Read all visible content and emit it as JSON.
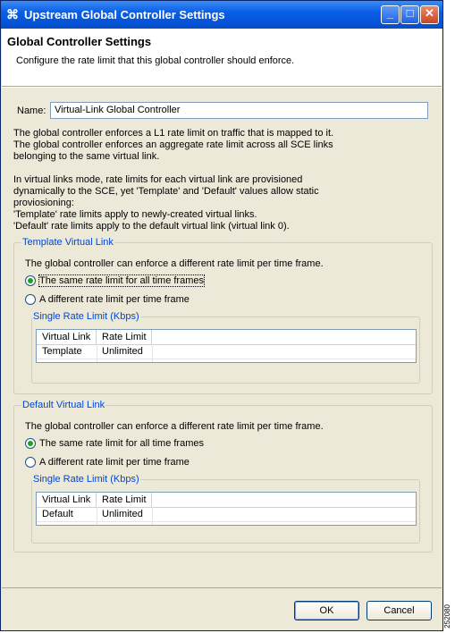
{
  "window": {
    "title": "Upstream Global Controller Settings",
    "minimize_glyph": "_",
    "maximize_glyph": "□",
    "close_glyph": "✕",
    "logo_glyph": "⌘"
  },
  "header": {
    "title": "Global Controller Settings",
    "description": "Configure the rate limit that this global controller should enforce."
  },
  "form": {
    "name_label": "Name:",
    "name_value": "Virtual-Link Global Controller"
  },
  "info": {
    "line1": "The global controller enforces a L1 rate limit on traffic that is mapped to it.",
    "line2": "The global controller enforces an aggregate rate limit across all SCE links",
    "line3": "belonging to the same virtual link.",
    "line4": "In virtual links mode, rate limits for each virtual link are provisioned",
    "line5": "dynamically to the SCE, yet 'Template' and 'Default' values allow static",
    "line6": "proviosioning:",
    "line7": "'Template' rate limits apply to newly-created virtual links.",
    "line8": "'Default' rate limits apply to the default virtual link (virtual link 0)."
  },
  "template_group": {
    "legend": "Template Virtual Link",
    "description": "The global controller can enforce a different rate limit per time frame.",
    "option_same": "The same rate limit for all time frames",
    "option_different": "A different rate limit per time frame",
    "selected": "same",
    "sub_legend": "Single Rate Limit (Kbps)",
    "columns": [
      "Virtual Link",
      "Rate Limit"
    ],
    "rows": [
      [
        "Template",
        "Unlimited"
      ]
    ]
  },
  "default_group": {
    "legend": "Default Virtual Link",
    "description": "The global controller can enforce a different rate limit per time frame.",
    "option_same": "The same rate limit for all time frames",
    "option_different": "A different rate limit per time frame",
    "selected": "same",
    "sub_legend": "Single Rate Limit (Kbps)",
    "columns": [
      "Virtual Link",
      "Rate Limit"
    ],
    "rows": [
      [
        "Default",
        "Unlimited"
      ]
    ]
  },
  "buttons": {
    "ok": "OK",
    "cancel": "Cancel"
  },
  "figure_number": "252080",
  "colors": {
    "titlebar": "#0a5fe8",
    "legend_text": "#0046d5",
    "radio_selected": "#21a121"
  }
}
